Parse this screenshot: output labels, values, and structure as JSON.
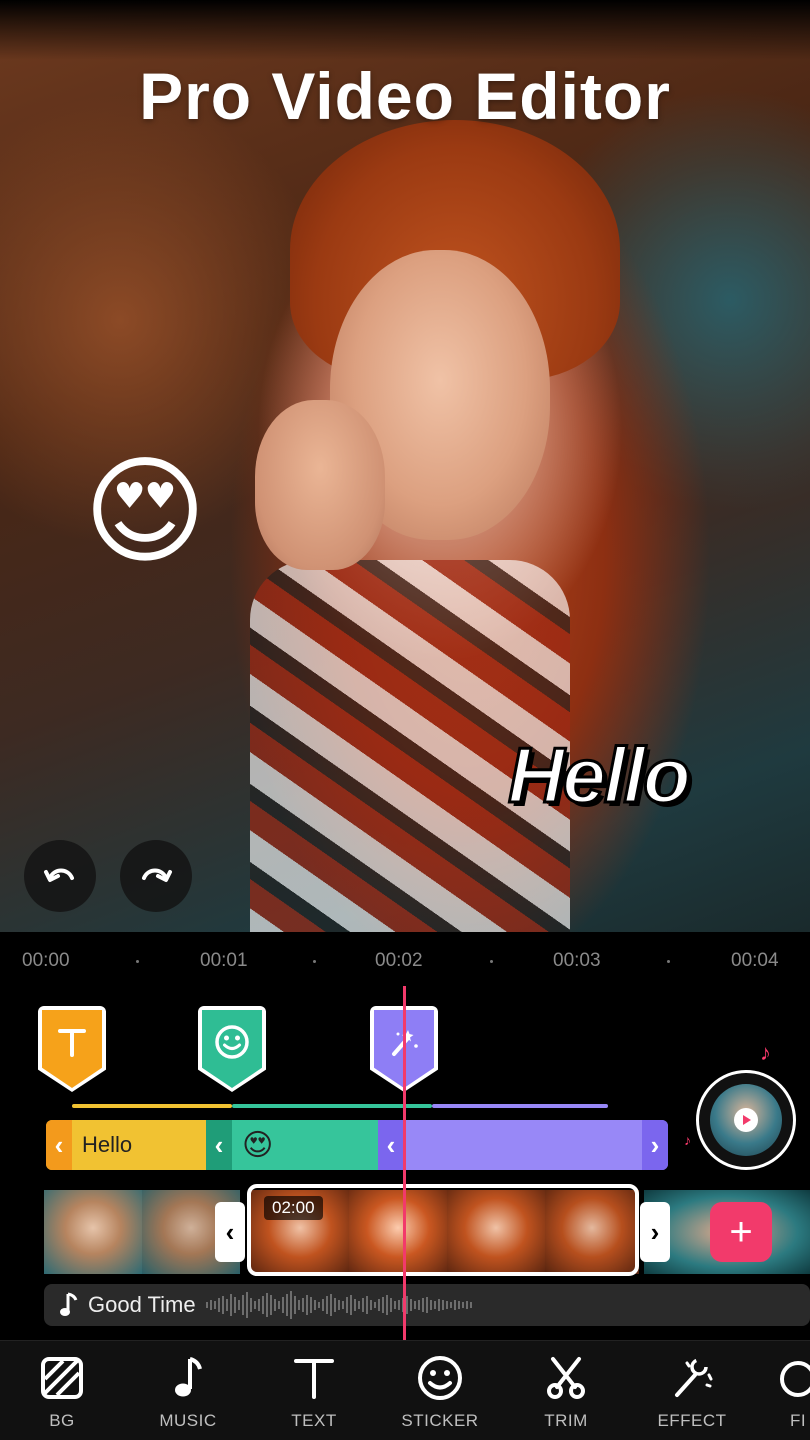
{
  "header": {
    "title": "Pro Video Editor"
  },
  "preview": {
    "emoji_sticker": "😍",
    "text_sticker": "Hello"
  },
  "timeline": {
    "ruler": [
      "00:00",
      "00:01",
      "00:02",
      "00:03",
      "00:04"
    ],
    "layers": {
      "text_label": "Hello",
      "sticker_emoji": "😍"
    },
    "clip_time": "02:00",
    "add_symbol": "+",
    "music_track": "Good Time"
  },
  "toolbar": {
    "items": [
      {
        "label": "BG",
        "icon": "background-icon"
      },
      {
        "label": "MUSIC",
        "icon": "music-note-icon"
      },
      {
        "label": "TEXT",
        "icon": "text-icon"
      },
      {
        "label": "STICKER",
        "icon": "smiley-icon"
      },
      {
        "label": "TRIM",
        "icon": "scissors-icon"
      },
      {
        "label": "EFFECT",
        "icon": "magic-wand-icon"
      },
      {
        "label": "FI",
        "icon": "filter-icon"
      }
    ]
  },
  "colors": {
    "accent": "#f23a6b",
    "text_layer": "#f1c232",
    "sticker_layer": "#36c59b",
    "effect_layer": "#9888f7"
  }
}
